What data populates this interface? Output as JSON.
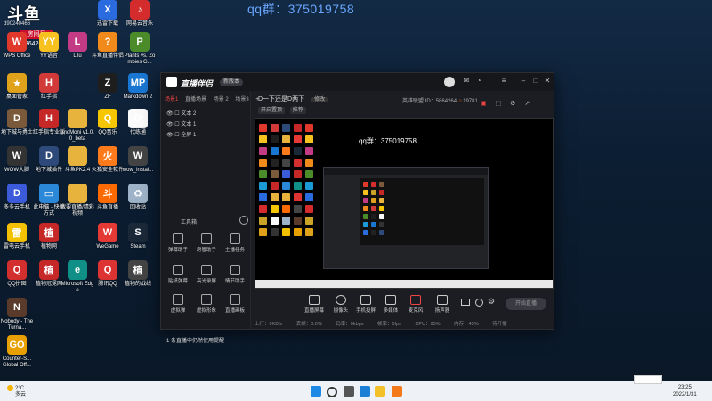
{
  "overlay": {
    "logo": "斗鱼",
    "id": "d90240466",
    "room_label": "房间号",
    "room_number": "5864264"
  },
  "qq_banner": "qq群：375019758",
  "desktop_icons": [
    {
      "label": "WPS Office",
      "glyph": "W",
      "color": "#e0392c"
    },
    {
      "label": "YY语音",
      "glyph": "YY",
      "color": "#f7c21f"
    },
    {
      "label": "Lilu",
      "glyph": "L",
      "color": "#c23b84"
    },
    {
      "label": "斗鱼直播伴侣",
      "glyph": "?",
      "color": "#f08a1a"
    },
    {
      "label": "Plants vs. Zombies G...",
      "glyph": "P",
      "color": "#4b8b2a"
    },
    {
      "label": "网易UU加速器",
      "glyph": "U",
      "color": "#1b9bd6"
    },
    {
      "label": "迅雷下载",
      "glyph": "X",
      "color": "#2a6be0"
    },
    {
      "label": "网易云音乐",
      "glyph": "♪",
      "color": "#d42c2c"
    },
    {
      "label": "暴雪战网",
      "glyph": "B",
      "color": "#c9a227"
    },
    {
      "label": "桌面管家",
      "glyph": "★",
      "color": "#e0a21a"
    },
    {
      "label": "红手指",
      "glyph": "H",
      "color": "#d23a3a"
    },
    {
      "label": "ZF",
      "glyph": "Z",
      "color": "#1e1e1e"
    },
    {
      "label": "Markdown 2",
      "glyph": "MP",
      "color": "#1976d2"
    },
    {
      "label": "黑盒工具",
      "glyph": "H",
      "color": "#222"
    },
    {
      "label": "地下城与勇士",
      "glyph": "D",
      "color": "#7a5a3a"
    },
    {
      "label": "红手指专业版",
      "glyph": "H",
      "color": "#c62828"
    },
    {
      "label": "ImoMoni v1.0.0_beta",
      "glyph": "",
      "color": "#e8b33c"
    },
    {
      "label": "QQ音乐",
      "glyph": "Q",
      "color": "#f6c700"
    },
    {
      "label": "代练通",
      "glyph": "D",
      "color": "#fafafa"
    },
    {
      "label": "WOW大脚",
      "glyph": "W",
      "color": "#333"
    },
    {
      "label": "地下城插件",
      "glyph": "D",
      "color": "#2e4a7a"
    },
    {
      "label": "斗鱼PK2.4",
      "glyph": "",
      "color": "#e8b33c"
    },
    {
      "label": "火狐安全软件",
      "glyph": "火",
      "color": "#ff7a1a"
    },
    {
      "label": "wow_instal...",
      "glyph": "W",
      "color": "#444"
    },
    {
      "label": "多多云手机",
      "glyph": "D",
      "color": "#3b5bdb"
    },
    {
      "label": "此电脑 - 快捷方式",
      "glyph": "▭",
      "color": "#2b88d8"
    },
    {
      "label": "我要直播/精彩视频",
      "glyph": "",
      "color": "#e8b33c"
    },
    {
      "label": "斗鱼直播",
      "glyph": "斗",
      "color": "#ff6a00"
    },
    {
      "label": "回收站",
      "glyph": "♻",
      "color": "#9fb3c8"
    },
    {
      "label": "雷电云手机",
      "glyph": "雷",
      "color": "#f3c100"
    },
    {
      "label": "植物网",
      "glyph": "植",
      "color": "#c62828"
    },
    {
      "label": "WeGame",
      "glyph": "W",
      "color": "#e53935"
    },
    {
      "label": "Steam",
      "glyph": "S",
      "color": "#1b2838"
    },
    {
      "label": "QQ拼图",
      "glyph": "Q",
      "color": "#d32f2f"
    },
    {
      "label": "植物冠冕网",
      "glyph": "植",
      "color": "#c62828"
    },
    {
      "label": "Microsoft Edge",
      "glyph": "e",
      "color": "#0f8f86"
    },
    {
      "label": "腾讯QQ",
      "glyph": "Q",
      "color": "#d33"
    },
    {
      "label": "植物的战线",
      "glyph": "植",
      "color": "#444"
    },
    {
      "label": "Nobody - The Turna...",
      "glyph": "N",
      "color": "#5a3a2a"
    },
    {
      "label": "Counter-S... Global Off...",
      "glyph": "GO",
      "color": "#e8a000"
    }
  ],
  "app": {
    "name": "直播伴侣",
    "badge": "新版本",
    "side_tabs": [
      "场景1",
      "直播场景",
      "场景 2",
      "场景3"
    ],
    "scenes": [
      "文本 2",
      "文本 1",
      "全屏 1"
    ],
    "tools_title": "工具箱",
    "tools": [
      "弹幕助手",
      "房管助手",
      "主播任务",
      "贴纸弹幕",
      "高光录屏",
      "情节助手",
      "虚拟弹",
      "虚拟形象",
      "直播画板"
    ],
    "live_hint": "1 条直播中仍然使用提醒",
    "center_title": "D一下还是D两下",
    "edit_label": "修改",
    "category": "英雄联盟",
    "room_id_label": "5864264",
    "popularity": "19781",
    "sub_tags": [
      "开启置顶",
      "推荐",
      "图片美颜",
      "游戏美颜"
    ],
    "preview_qq": "qq群：375019758",
    "controls": [
      "直播屏幕",
      "摄像头",
      "手机投屏",
      "多媒体",
      "麦克风",
      "扬声器"
    ],
    "start_live": "开始直播",
    "status": [
      "上行：0KB/s",
      "丢帧：0.0%",
      "码率：0kbps",
      "帧率：0fps",
      "CPU：95%",
      "内存：45%",
      "磁盘：40%",
      "待开播"
    ]
  },
  "taskbar": {
    "weather_temp": "2°C",
    "weather_text": "多云",
    "time": "23:25",
    "date": "2022/1/31"
  }
}
